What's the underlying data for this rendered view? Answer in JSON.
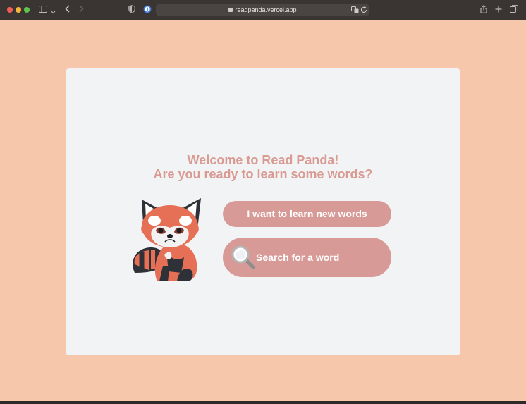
{
  "browser": {
    "url": "readpanda.vercel.app"
  },
  "page": {
    "title_line1": "Welcome to Read Panda!",
    "title_line2": "Are you ready to learn some words?",
    "learn_button": "I want to learn new words",
    "search_button": "Search for a word"
  },
  "colors": {
    "background": "#f6c7aa",
    "card": "#f2f3f5",
    "accent": "#d89a96",
    "title": "#d99a92"
  },
  "icons": [
    "red-panda-mascot-icon",
    "magnifier-icon"
  ]
}
